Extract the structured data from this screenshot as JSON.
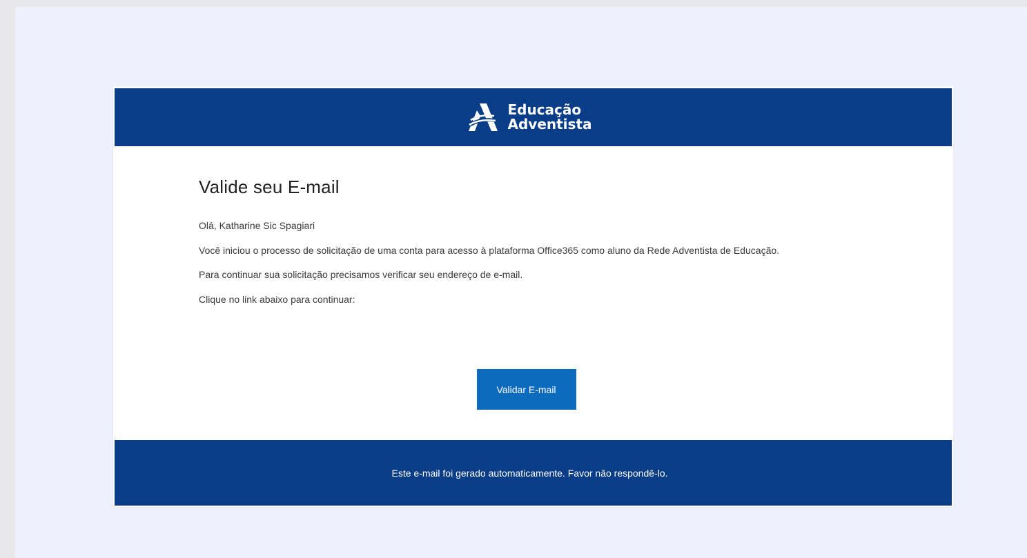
{
  "colors": {
    "brand_navy": "#0a3d87",
    "button_blue": "#0c6bbd",
    "page_background": "#eef0fc",
    "outer_background": "#e8e8ea"
  },
  "header": {
    "logo_icon": "educacao-adventista-logo-icon",
    "logo_line1": "Educação",
    "logo_line2": "Adventista"
  },
  "body": {
    "title": "Valide seu E-mail",
    "greeting": "Olá, Katharine Sic Spagiari",
    "intro": "Você iniciou o processo de solicitação de uma conta para acesso à plataforma Office365 como aluno da Rede Adventista de Educação.",
    "verify_text": "Para continuar sua solicitação precisamos verificar seu endereço de e-mail.",
    "click_text": "Clique no link abaixo para continuar:"
  },
  "cta": {
    "label": "Validar E-mail"
  },
  "footer": {
    "text": "Este e-mail foi gerado automaticamente. Favor não respondê-lo."
  }
}
